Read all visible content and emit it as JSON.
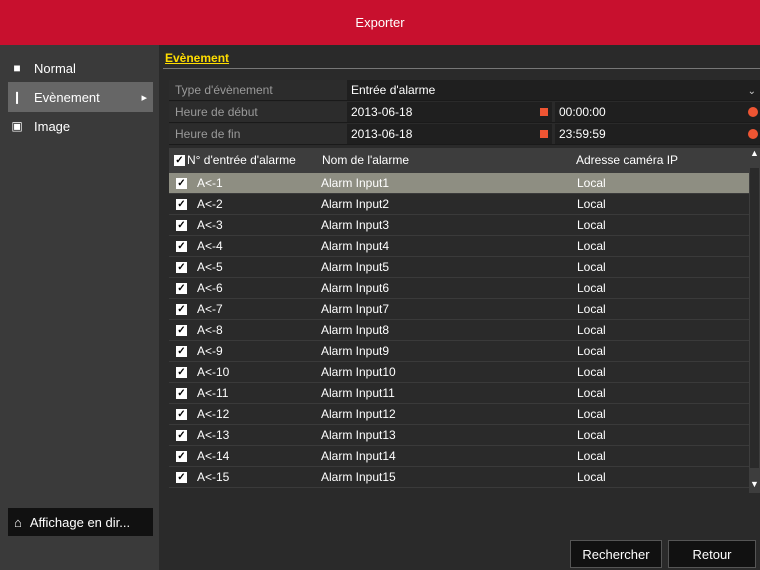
{
  "window": {
    "title": "Exporter"
  },
  "sidebar": {
    "items": [
      {
        "label": "Normal",
        "icon": "folder-icon"
      },
      {
        "label": "Evènement",
        "icon": "alarm-icon",
        "active": true
      },
      {
        "label": "Image",
        "icon": "image-icon"
      }
    ],
    "bottom": {
      "label": "Affichage en dir...",
      "icon": "home-icon"
    }
  },
  "main": {
    "section_tab": "Evènement",
    "form": {
      "event_type_label": "Type d'évènement",
      "event_type_value": "Entrée d'alarme",
      "start_label": "Heure de début",
      "start_date": "2013-06-18",
      "start_time": "00:00:00",
      "end_label": "Heure de fin",
      "end_date": "2013-06-18",
      "end_time": "23:59:59"
    },
    "table": {
      "headers": [
        "N° d'entrée d'alarme",
        "Nom de l'alarme",
        "Adresse caméra IP"
      ],
      "rows": [
        [
          "A<-1",
          "Alarm Input1",
          "Local"
        ],
        [
          "A<-2",
          "Alarm Input2",
          "Local"
        ],
        [
          "A<-3",
          "Alarm Input3",
          "Local"
        ],
        [
          "A<-4",
          "Alarm Input4",
          "Local"
        ],
        [
          "A<-5",
          "Alarm Input5",
          "Local"
        ],
        [
          "A<-6",
          "Alarm Input6",
          "Local"
        ],
        [
          "A<-7",
          "Alarm Input7",
          "Local"
        ],
        [
          "A<-8",
          "Alarm Input8",
          "Local"
        ],
        [
          "A<-9",
          "Alarm Input9",
          "Local"
        ],
        [
          "A<-10",
          "Alarm Input10",
          "Local"
        ],
        [
          "A<-11",
          "Alarm Input11",
          "Local"
        ],
        [
          "A<-12",
          "Alarm Input12",
          "Local"
        ],
        [
          "A<-13",
          "Alarm Input13",
          "Local"
        ],
        [
          "A<-14",
          "Alarm Input14",
          "Local"
        ],
        [
          "A<-15",
          "Alarm Input15",
          "Local"
        ]
      ]
    },
    "buttons": {
      "search": "Rechercher",
      "back": "Retour"
    }
  },
  "colors": {
    "titlebar": "#c8102e",
    "tab_accent": "#ffdd00",
    "selected_row": "#8e8e82"
  }
}
